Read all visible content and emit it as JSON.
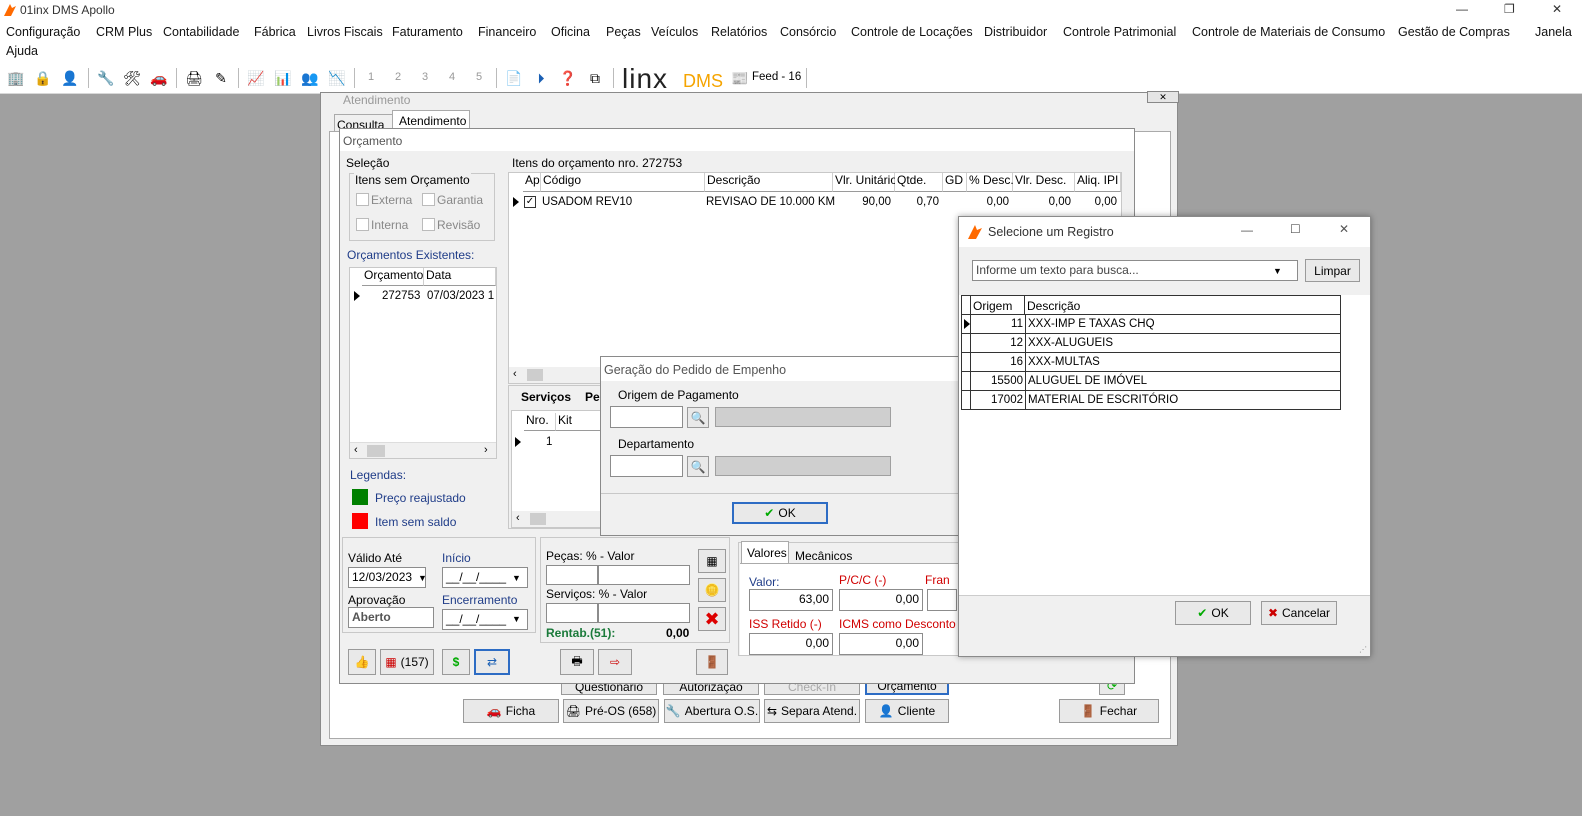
{
  "app": {
    "title": "01inx DMS Apollo"
  },
  "menu": [
    "Configuração",
    "CRM Plus",
    "Contabilidade",
    "Fábrica",
    "Livros Fiscais",
    "Faturamento",
    "Financeiro",
    "Oficina",
    "Peças",
    "Veículos",
    "Relatórios",
    "Consórcio",
    "Controle de Locações",
    "Distribuidor",
    "Controle Patrimonial",
    "Controle de Materiais de Consumo",
    "Gestão de Compras",
    "Janela",
    "Ajuda"
  ],
  "toolbar": {
    "nums": [
      "1",
      "2",
      "3",
      "4",
      "5"
    ],
    "brand": "linx",
    "brand_suffix": "DMS",
    "feed": "Feed - 16"
  },
  "atendimento": {
    "title": "Atendimento",
    "tabs": [
      "Consulta",
      "Atendimento"
    ],
    "buttons": [
      "Questionário",
      "Autorização",
      "Check-In",
      "Orçamento"
    ],
    "bottom_buttons": [
      "Ficha",
      "Pré-OS (658)",
      "Abertura O.S.",
      "Separa Atend.",
      "Cliente",
      "Fechar"
    ]
  },
  "orcamento": {
    "title": "Orçamento",
    "selecao": "Seleção",
    "itens_sem": "Itens sem Orçamento",
    "chk": [
      "Externa",
      "Garantia",
      "Interna",
      "Revisão"
    ],
    "existentes": "Orçamentos Existentes:",
    "exist_cols": [
      "Orçamento",
      "Data"
    ],
    "exist_row": [
      "272753",
      "07/03/2023 1"
    ],
    "legendas": "Legendas:",
    "leg": [
      "Preço reajustado",
      "Item sem saldo"
    ],
    "itens_title": "Itens do orçamento nro. 272753",
    "cols": [
      "Ap",
      "Código",
      "Descrição",
      "Vlr. Unitário",
      "Qtde.",
      "GD",
      "% Desc.",
      "Vlr. Desc.",
      "Aliq. IPI"
    ],
    "row": [
      "USADOM REV10",
      "REVISAO DE 10.000 KM",
      "90,00",
      "0,70",
      "",
      "0,00",
      "0,00",
      "0,00"
    ],
    "subtabs": [
      "Serviços",
      "Pe"
    ],
    "sub_cols": [
      "Nro.",
      "Kit"
    ],
    "sub_row": "1",
    "valido": "Válido Até",
    "valido_val": "12/03/2023",
    "inicio": "Início",
    "inicio_val": "__/__/____",
    "aprovacao": "Aprovação",
    "aprov_val": "Aberto",
    "encerramento": "Encerramento",
    "encerr_val": "__/__/____",
    "pecas": "Peças: % - Valor",
    "servicos": "Serviços: % - Valor",
    "rentab": "Rentab.(51):",
    "rentab_val": "0,00",
    "count157": "(157)",
    "val_tabs": [
      "Valores",
      "Mecânicos"
    ],
    "valor": "Valor:",
    "valor_val": "63,00",
    "pcc": "P/C/C (-)",
    "pcc_val": "0,00",
    "fran": "Fran",
    "iss": "ISS Retido (-)",
    "iss_val": "0,00",
    "icms": "ICMS como Desconto (",
    "icms_val": "0,00"
  },
  "empenho": {
    "title": "Geração do Pedido de Empenho",
    "origem": "Origem de Pagamento",
    "depto": "Departamento",
    "ok": "OK"
  },
  "registro": {
    "title": "Selecione um Registro",
    "placeholder": "Informe um texto para busca...",
    "limpar": "Limpar",
    "cols": [
      "Origem",
      "Descrição"
    ],
    "rows": [
      {
        "o": "11",
        "d": "XXX-IMP E TAXAS CHQ"
      },
      {
        "o": "12",
        "d": "XXX-ALUGUEIS"
      },
      {
        "o": "16",
        "d": "XXX-MULTAS"
      },
      {
        "o": "15500",
        "d": "ALUGUEL DE IMÓVEL"
      },
      {
        "o": "17002",
        "d": "MATERIAL DE ESCRITÓRIO"
      }
    ],
    "ok": "OK",
    "cancelar": "Cancelar"
  },
  "colors": {
    "accent": "#ff6a00",
    "green": "#008000",
    "red": "#ff0000",
    "blue_label": "#1f3c88"
  }
}
